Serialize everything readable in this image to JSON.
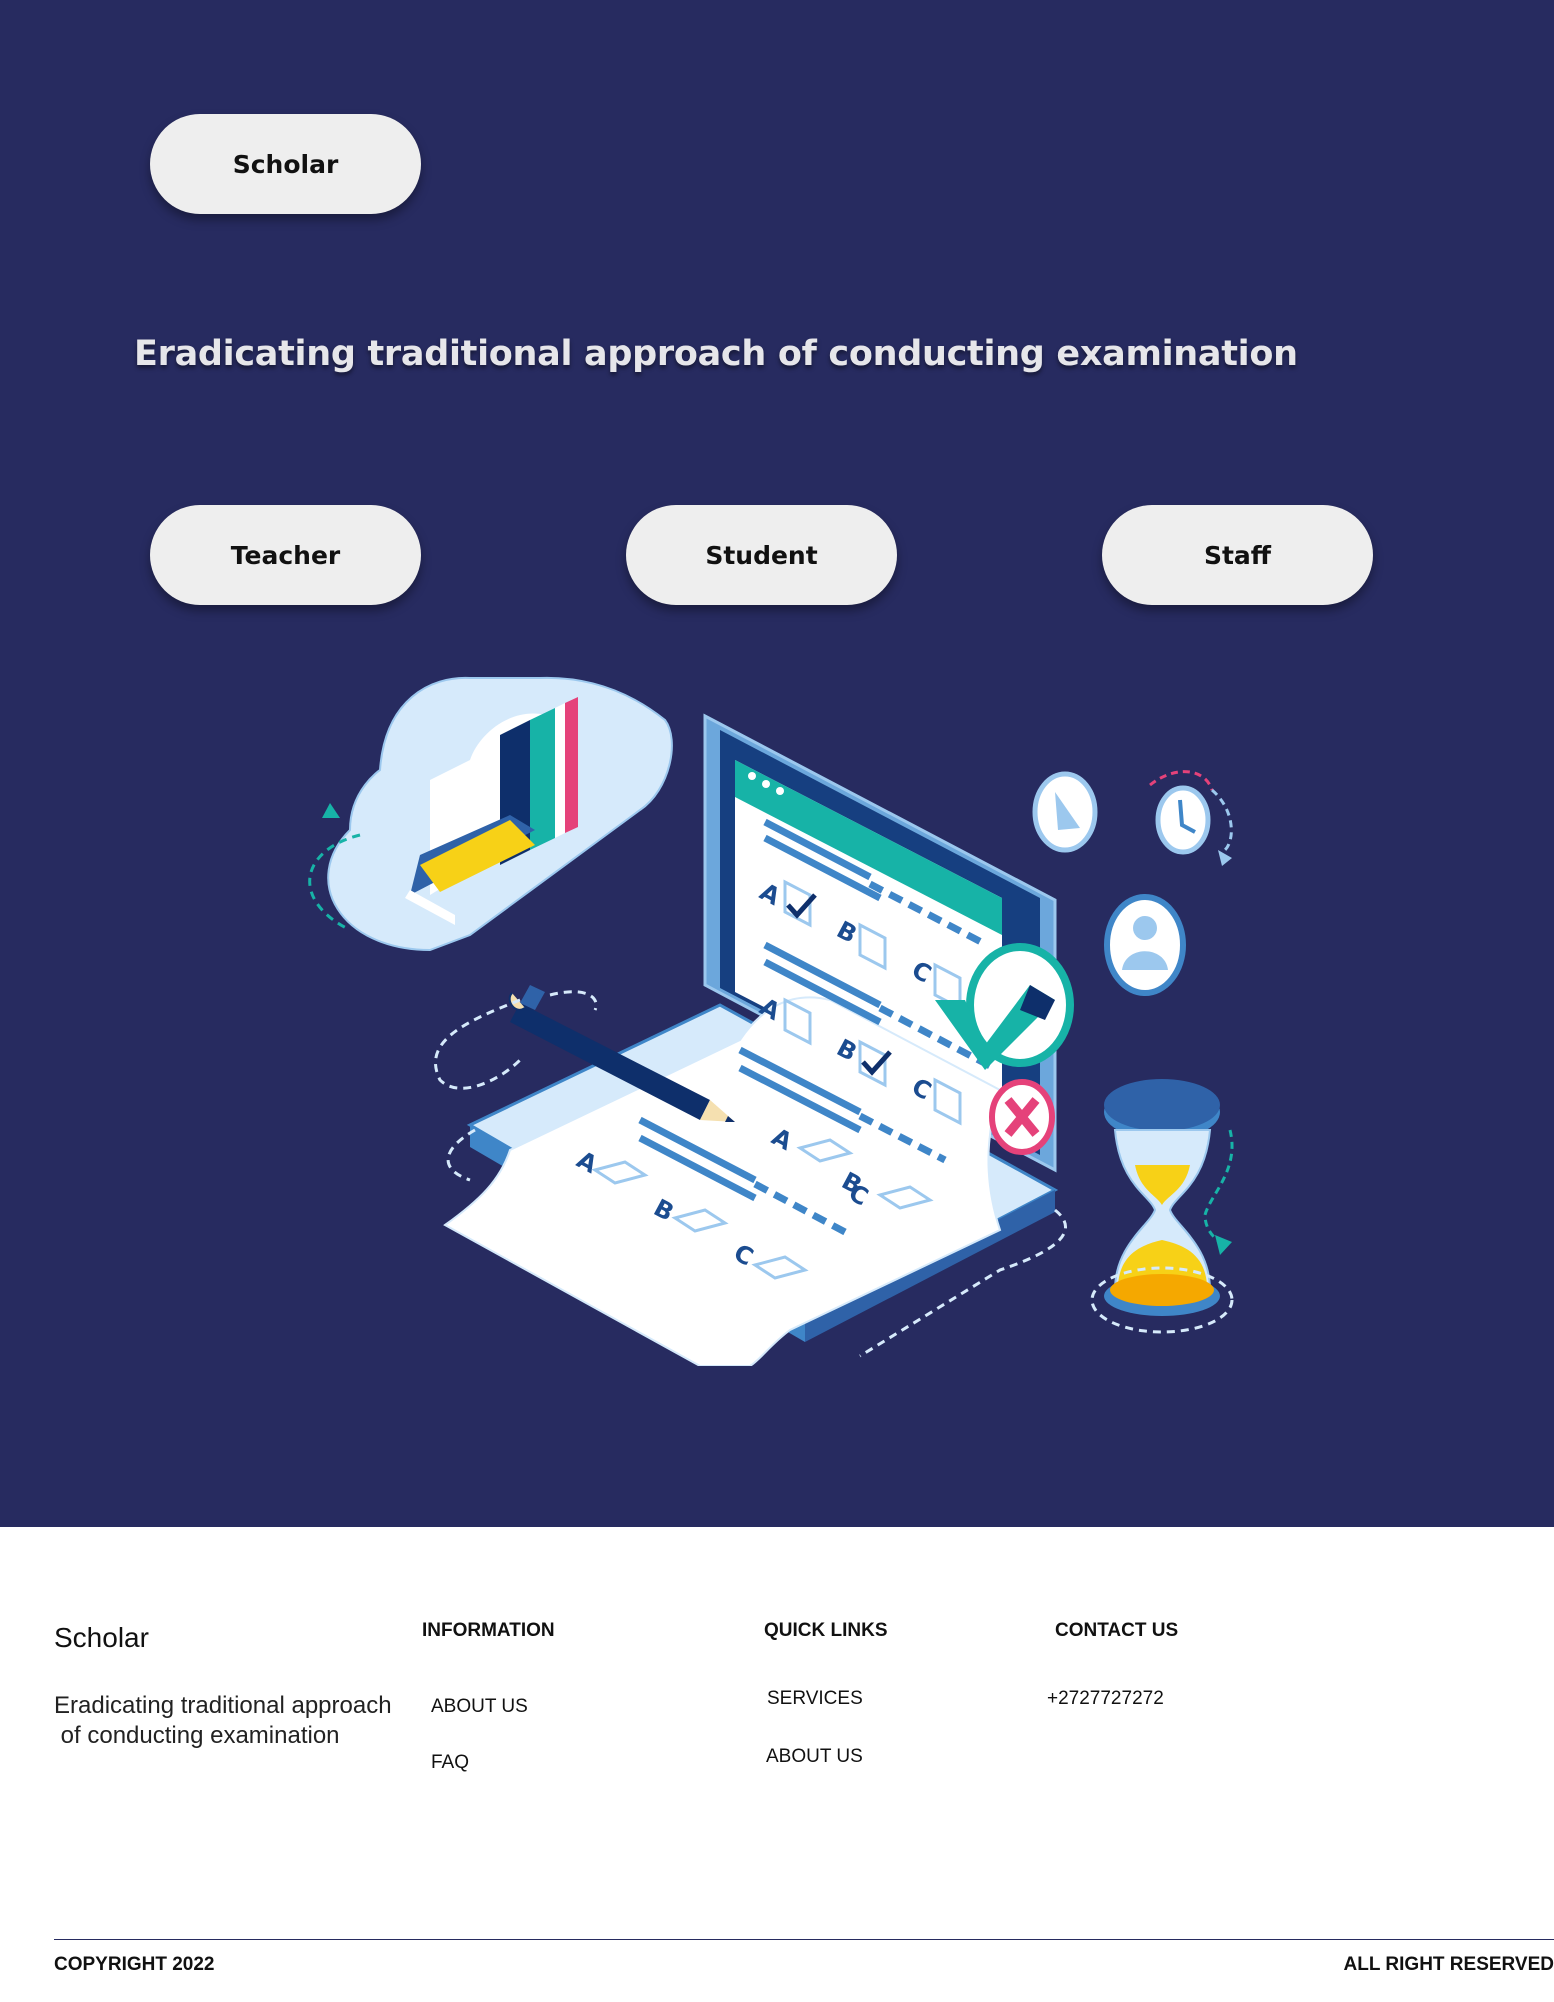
{
  "hero": {
    "brand_button": "Scholar",
    "headline": "Eradicating traditional approach of conducting examination",
    "role_buttons": [
      "Teacher",
      "Student",
      "Staff"
    ],
    "illustration": {
      "options_row1": [
        "A",
        "B",
        "C"
      ],
      "options_row2": [
        "A",
        "B",
        "C"
      ],
      "options_row3": [
        "A",
        "B",
        "C"
      ],
      "options_row4": [
        "A",
        "B",
        "C"
      ]
    }
  },
  "footer": {
    "brand": "Scholar",
    "description": "Eradicating traditional approach\n of conducting examination",
    "information": {
      "heading": "INFORMATION",
      "links": [
        "ABOUT US",
        "FAQ"
      ]
    },
    "quick_links": {
      "heading": "QUICK LINKS",
      "links": [
        "SERVICES",
        "ABOUT US"
      ]
    },
    "contact": {
      "heading": "CONTACT US",
      "phone": "+2727727272"
    },
    "copyright": "COPYRIGHT 2022",
    "rights": "ALL RIGHT RESERVED"
  },
  "colors": {
    "hero_bg": "#272b60",
    "pill_bg": "#eeeeee",
    "accent_teal": "#17b3a7",
    "accent_blue": "#3f86c8",
    "accent_yellow": "#f7d117",
    "accent_pink": "#e5427a"
  }
}
